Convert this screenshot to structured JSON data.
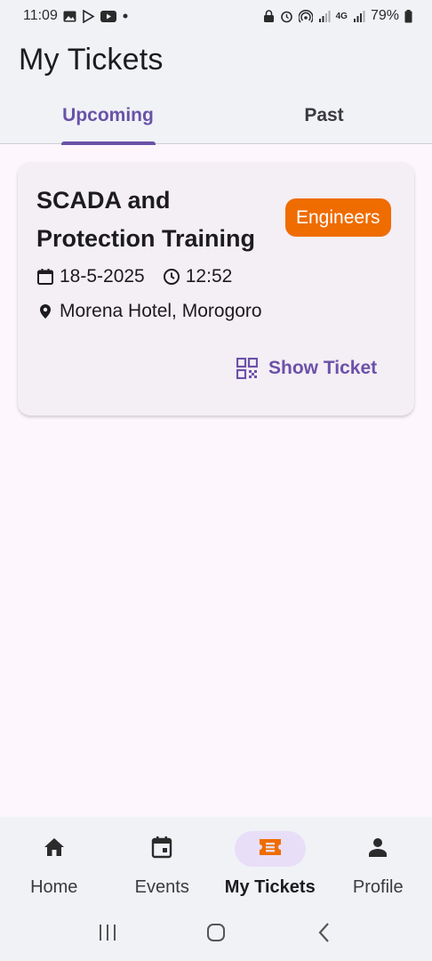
{
  "status_bar": {
    "time": "11:09",
    "battery": "79%",
    "network": "4G"
  },
  "header": {
    "title": "My Tickets"
  },
  "tabs": [
    {
      "label": "Upcoming",
      "active": true
    },
    {
      "label": "Past",
      "active": false
    }
  ],
  "ticket": {
    "title": "SCADA and Protection Training",
    "category": "Engineers",
    "date": "18-5-2025",
    "time": "12:52",
    "location": "Morena Hotel, Morogoro",
    "action_label": "Show Ticket"
  },
  "bottom_nav": [
    {
      "label": "Home",
      "icon": "home-icon",
      "active": false
    },
    {
      "label": "Events",
      "icon": "calendar-icon",
      "active": false
    },
    {
      "label": "My Tickets",
      "icon": "ticket-icon",
      "active": true
    },
    {
      "label": "Profile",
      "icon": "person-icon",
      "active": false
    }
  ],
  "colors": {
    "accent": "#6a52a8",
    "badge": "#ef6c00",
    "nav_active_pill": "#e8def8",
    "active_icon": "#ef6c00"
  }
}
